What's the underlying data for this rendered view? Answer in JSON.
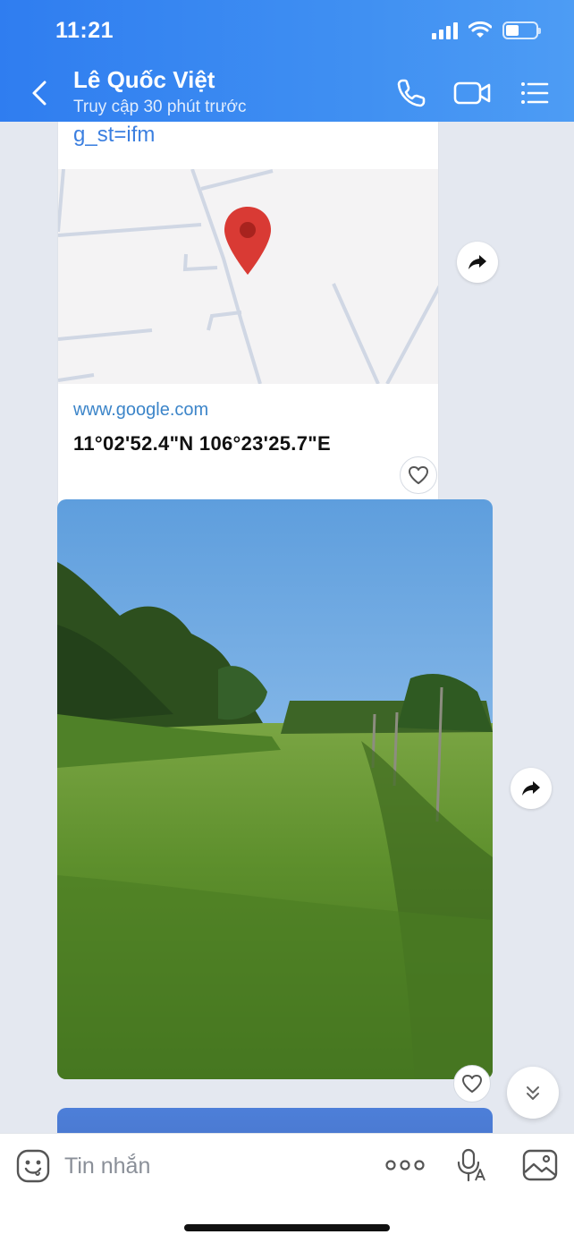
{
  "status_bar": {
    "time": "11:21",
    "battery_level": 0.45
  },
  "header": {
    "contact_name": "Lê Quốc Việt",
    "contact_status": "Truy cập 30 phút trước",
    "icons": [
      "back-arrow-icon",
      "phone-icon",
      "video-call-icon",
      "menu-list-icon"
    ]
  },
  "link_message": {
    "url_tail": "g_st=ifm",
    "domain": "www.google.com",
    "title": "11°02'52.4\"N 106°23'25.7\"E"
  },
  "input_bar": {
    "placeholder": "Tin nhắn",
    "icons": [
      "emoji-icon",
      "more-dots-icon",
      "voice-mic-icon",
      "image-icon"
    ]
  },
  "colors": {
    "header_start": "#2f7df0",
    "header_end": "#4d9cf4",
    "chat_background": "#e4e8f0",
    "link_color": "#3c85c9",
    "map_pin": "#d93a34"
  }
}
